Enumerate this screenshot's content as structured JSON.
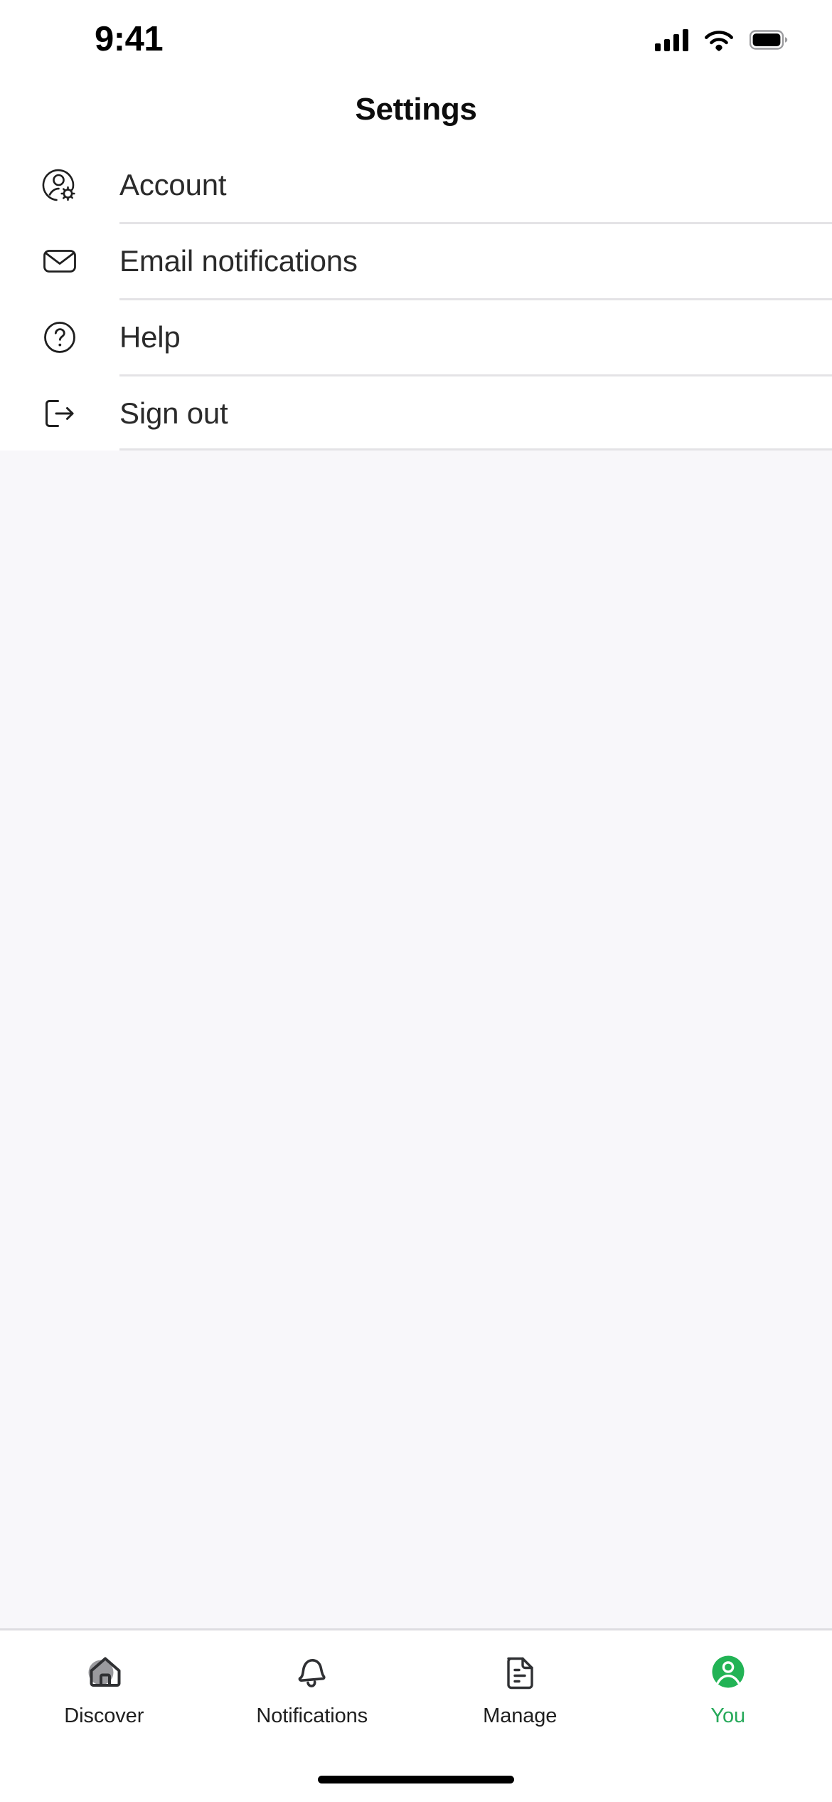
{
  "status_bar": {
    "time": "9:41",
    "cellular_icon": "signal-bars-icon",
    "wifi_icon": "wifi-icon",
    "battery_icon": "battery-full-icon"
  },
  "header": {
    "title": "Settings"
  },
  "settings_list": {
    "items": [
      {
        "label": "Account",
        "icon": "account-gear-icon"
      },
      {
        "label": "Email notifications",
        "icon": "envelope-icon"
      },
      {
        "label": "Help",
        "icon": "question-circle-icon"
      },
      {
        "label": "Sign out",
        "icon": "sign-out-icon"
      }
    ]
  },
  "tab_bar": {
    "tabs": [
      {
        "label": "Discover",
        "icon": "home-icon",
        "active": false
      },
      {
        "label": "Notifications",
        "icon": "bell-icon",
        "active": false
      },
      {
        "label": "Manage",
        "icon": "document-icon",
        "active": false
      },
      {
        "label": "You",
        "icon": "person-avatar-icon",
        "active": true
      }
    ]
  },
  "colors": {
    "accent_green": "#26a95a",
    "avatar_green": "#22b355",
    "page_background": "#f8f7fa",
    "surface": "#ffffff",
    "divider": "#e4e3e6",
    "text_primary": "#2a2a2a",
    "icon_stroke": "#1f1f1f",
    "home_icon_circle": "#9a9a9e"
  }
}
